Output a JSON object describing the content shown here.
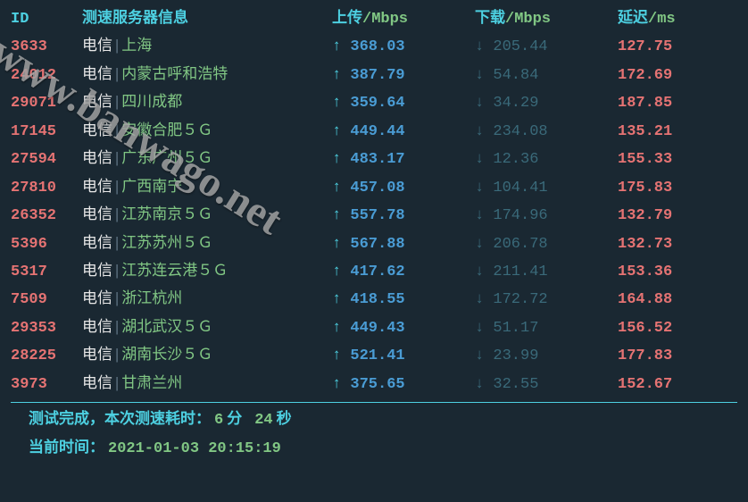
{
  "header": {
    "id": "ID",
    "server_info": "测速服务器信息",
    "upload_label": "上传",
    "upload_unit": "/Mbps",
    "download_label": "下载",
    "download_unit": "/Mbps",
    "latency_label": "延迟",
    "latency_unit": "/ms"
  },
  "rows": [
    {
      "id": "3633",
      "isp": "电信",
      "sep": "|",
      "loc": "上海",
      "up": "368.03",
      "down": "205.44",
      "lat": "127.75"
    },
    {
      "id": "24012",
      "isp": "电信",
      "sep": "|",
      "loc": "内蒙古呼和浩特",
      "up": "387.79",
      "down": "54.84",
      "lat": "172.69"
    },
    {
      "id": "29071",
      "isp": "电信",
      "sep": "|",
      "loc": "四川成都",
      "up": "359.64",
      "down": "34.29",
      "lat": "187.85"
    },
    {
      "id": "17145",
      "isp": "电信",
      "sep": "|",
      "loc": "安徽合肥５Ｇ",
      "up": "449.44",
      "down": "234.08",
      "lat": "135.21"
    },
    {
      "id": "27594",
      "isp": "电信",
      "sep": "|",
      "loc": "广东广州５Ｇ",
      "up": "483.17",
      "down": "12.36",
      "lat": "155.33"
    },
    {
      "id": "27810",
      "isp": "电信",
      "sep": "|",
      "loc": "广西南宁",
      "up": "457.08",
      "down": "104.41",
      "lat": "175.83"
    },
    {
      "id": "26352",
      "isp": "电信",
      "sep": "|",
      "loc": "江苏南京５Ｇ",
      "up": "557.78",
      "down": "174.96",
      "lat": "132.79"
    },
    {
      "id": "5396",
      "isp": "电信",
      "sep": "|",
      "loc": "江苏苏州５Ｇ",
      "up": "567.88",
      "down": "206.78",
      "lat": "132.73"
    },
    {
      "id": "5317",
      "isp": "电信",
      "sep": "|",
      "loc": "江苏连云港５Ｇ",
      "up": "417.62",
      "down": "211.41",
      "lat": "153.36"
    },
    {
      "id": "7509",
      "isp": "电信",
      "sep": "|",
      "loc": "浙江杭州",
      "up": "418.55",
      "down": "172.72",
      "lat": "164.88"
    },
    {
      "id": "29353",
      "isp": "电信",
      "sep": "|",
      "loc": "湖北武汉５Ｇ",
      "up": "449.43",
      "down": "51.17",
      "lat": "156.52"
    },
    {
      "id": "28225",
      "isp": "电信",
      "sep": "|",
      "loc": "湖南长沙５Ｇ",
      "up": "521.41",
      "down": "23.99",
      "lat": "177.83"
    },
    {
      "id": "3973",
      "isp": "电信",
      "sep": "|",
      "loc": "甘肃兰州",
      "up": "375.65",
      "down": "32.55",
      "lat": "152.67"
    }
  ],
  "footer": {
    "complete_label": "测试完成，本次测速耗时：",
    "duration_min": "6",
    "min_unit": "分",
    "duration_sec": "24",
    "sec_unit": "秒",
    "time_label": "当前时间：",
    "timestamp": "2021-01-03 20:15:19"
  },
  "watermark": "www.banwago.net",
  "arrows": {
    "up": "↑",
    "down": "↓"
  }
}
